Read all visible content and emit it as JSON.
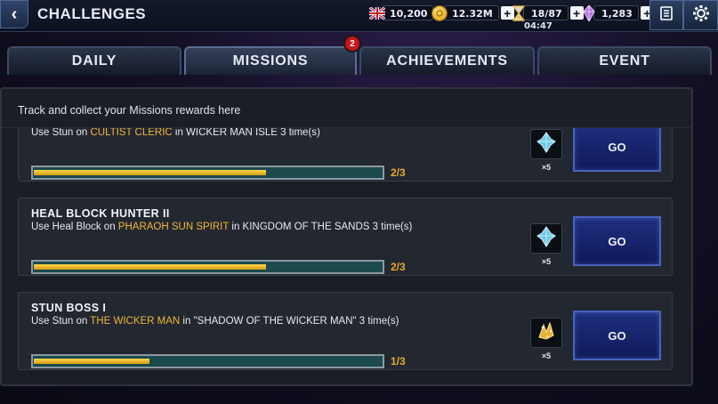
{
  "header": {
    "title": "CHALLENGES",
    "back_icon": "chevron-left-icon",
    "currencies": [
      {
        "icon": "flag-icon",
        "value": "10,200",
        "has_plus": false
      },
      {
        "icon": "gold-coin-icon",
        "value": "12.32M",
        "has_plus": true
      },
      {
        "icon": "hourglass-icon",
        "value": "18/87",
        "has_plus": true
      },
      {
        "icon": "crystal-icon",
        "value": "1,283",
        "has_plus": true
      }
    ],
    "energy_timer": "04:47",
    "plus_label": "+",
    "menu_icons": [
      "notes-icon",
      "gear-icon"
    ]
  },
  "tabs": [
    {
      "label": "DAILY",
      "active": false
    },
    {
      "label": "MISSIONS",
      "active": true,
      "badge": "2"
    },
    {
      "label": "ACHIEVEMENTS",
      "active": false
    },
    {
      "label": "EVENT",
      "active": false
    }
  ],
  "panel": {
    "subtitle": "Track and collect your Missions rewards here",
    "missions": [
      {
        "title": "",
        "desc_pre": "Use Stun on ",
        "desc_target": "CULTIST CLERIC",
        "desc_post": " in WICKER MAN ISLE 3 time(s)",
        "progress_text": "2/3",
        "progress_fraction": 0.667,
        "reward_icon": "blue-crystal-icon",
        "reward_qty": "×5",
        "button_label": "GO"
      },
      {
        "title": "HEAL BLOCK HUNTER II",
        "desc_pre": "Use Heal Block on ",
        "desc_target": "PHARAOH SUN SPIRIT",
        "desc_post": " in KINGDOM OF THE SANDS 3 time(s)",
        "progress_text": "2/3",
        "progress_fraction": 0.667,
        "reward_icon": "blue-crystal-icon",
        "reward_qty": "×5",
        "button_label": "GO"
      },
      {
        "title": "STUN BOSS I",
        "desc_pre": "Use Stun on ",
        "desc_target": "THE WICKER MAN",
        "desc_post": " in \"SHADOW OF THE WICKER MAN\" 3 time(s)",
        "progress_text": "1/3",
        "progress_fraction": 0.333,
        "reward_icon": "gold-shard-icon",
        "reward_qty": "×5",
        "button_label": "GO"
      }
    ]
  },
  "colors": {
    "accent_orange": "#f0b63c",
    "progress_gold": "#f3c12e",
    "button_blue": "#1b2a76",
    "badge_red": "#c8141b"
  }
}
